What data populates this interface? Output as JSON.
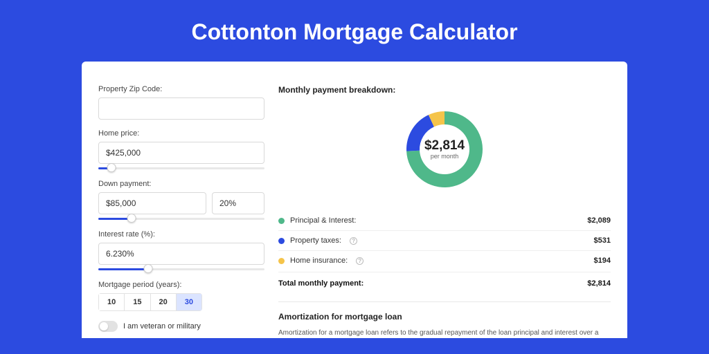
{
  "title": "Cottonton Mortgage Calculator",
  "form": {
    "zip_label": "Property Zip Code:",
    "zip_value": "",
    "price_label": "Home price:",
    "price_value": "$425,000",
    "price_slider_pct": 8,
    "down_label": "Down payment:",
    "down_value": "$85,000",
    "down_pct": "20%",
    "down_slider_pct": 20,
    "rate_label": "Interest rate (%):",
    "rate_value": "6.230%",
    "rate_slider_pct": 30,
    "period_label": "Mortgage period (years):",
    "periods": [
      "10",
      "15",
      "20",
      "30"
    ],
    "period_active": "30",
    "vet_label": "I am veteran or military"
  },
  "breakdown": {
    "title": "Monthly payment breakdown:",
    "center_amount": "$2,814",
    "center_sub": "per month",
    "items": [
      {
        "label": "Principal & Interest:",
        "value": "$2,089",
        "color": "g"
      },
      {
        "label": "Property taxes:",
        "value": "$531",
        "color": "b",
        "info": true
      },
      {
        "label": "Home insurance:",
        "value": "$194",
        "color": "y",
        "info": true
      }
    ],
    "total_label": "Total monthly payment:",
    "total_value": "$2,814"
  },
  "amort": {
    "title": "Amortization for mortgage loan",
    "body": "Amortization for a mortgage loan refers to the gradual repayment of the loan principal and interest over a specified"
  },
  "chart_data": {
    "type": "pie",
    "title": "Monthly payment breakdown",
    "categories": [
      "Principal & Interest",
      "Property taxes",
      "Home insurance"
    ],
    "values": [
      2089,
      531,
      194
    ],
    "colors": [
      "#4fb88a",
      "#2c4be0",
      "#f5c44a"
    ]
  }
}
